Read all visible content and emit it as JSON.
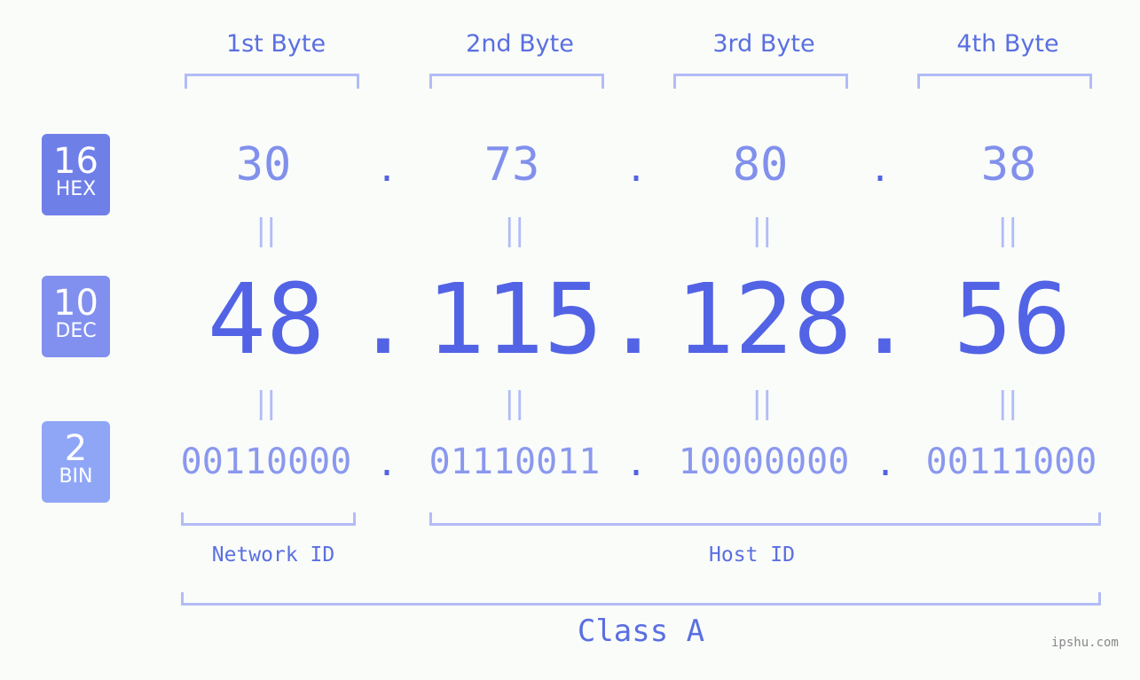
{
  "bytes": [
    {
      "label": "1st Byte",
      "hex": "30",
      "dec": "48",
      "bin": "00110000"
    },
    {
      "label": "2nd Byte",
      "hex": "73",
      "dec": "115",
      "bin": "01110011"
    },
    {
      "label": "3rd Byte",
      "hex": "80",
      "dec": "128",
      "bin": "10000000"
    },
    {
      "label": "4th Byte",
      "hex": "38",
      "dec": "56",
      "bin": "00111000"
    }
  ],
  "badges": {
    "hex": {
      "num": "16",
      "label": "HEX"
    },
    "dec": {
      "num": "10",
      "label": "DEC"
    },
    "bin": {
      "num": "2",
      "label": "BIN"
    }
  },
  "separator": ".",
  "equals": "||",
  "network_id_label": "Network ID",
  "host_id_label": "Host ID",
  "class_label": "Class A",
  "watermark": "ipshu.com",
  "colors": {
    "hex_badge": "#6f7fe8",
    "dec_badge": "#8190ee",
    "bin_badge": "#8fa6f6",
    "accent": "#5263e5",
    "bracket": "#b2bcf6"
  }
}
